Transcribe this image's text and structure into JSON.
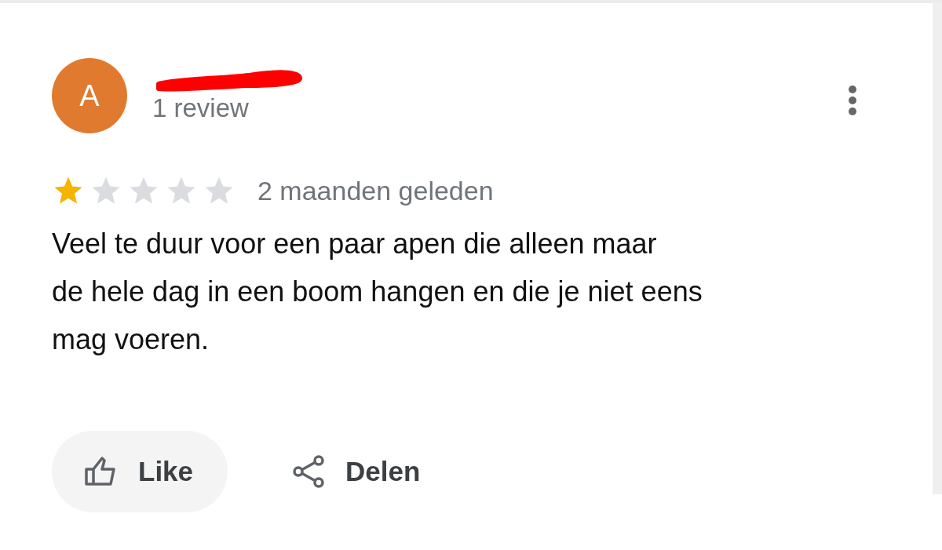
{
  "review": {
    "avatar_letter": "A",
    "review_count": "1 review",
    "stars": 1,
    "time": "2 maanden geleden",
    "text": "Veel te duur voor een paar apen die alleen maar\nde hele dag in een boom hangen en die je niet eens\nmag voeren."
  },
  "actions": [
    {
      "kind": "like",
      "label": "Like"
    },
    {
      "kind": "share",
      "label": "Delen"
    }
  ]
}
